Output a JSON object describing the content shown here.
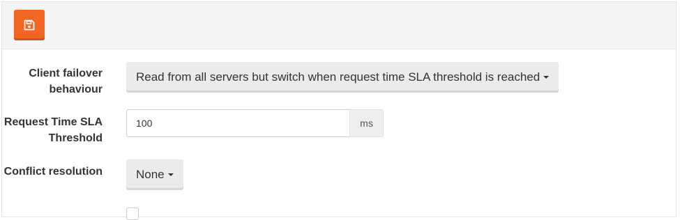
{
  "toolbar": {
    "save_icon": "floppy-disk-icon",
    "accent_color": "#f26522"
  },
  "form": {
    "failover": {
      "label": "Client failover behaviour",
      "selected": "Read from all servers but switch when request time SLA threshold is reached"
    },
    "sla_threshold": {
      "label": "Request Time SLA Threshold",
      "value": "100",
      "unit": "ms"
    },
    "conflict": {
      "label": "Conflict resolution",
      "selected": "None"
    }
  }
}
